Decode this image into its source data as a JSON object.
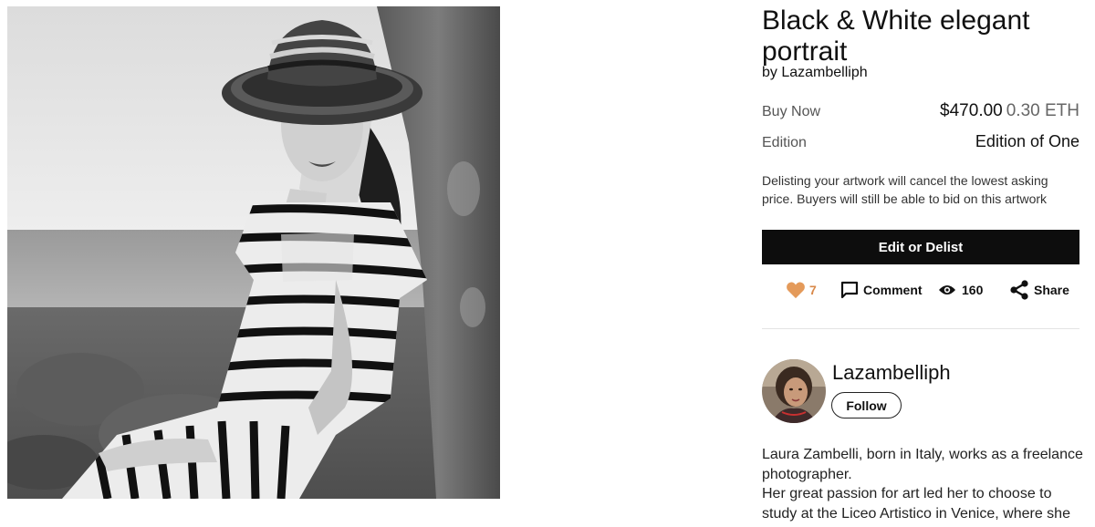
{
  "artwork": {
    "title": "Black & White elegant portrait",
    "artist_prefix": "by",
    "artist": "Lazambelliph"
  },
  "sale": {
    "buy_label": "Buy Now",
    "price_usd": "$470.00",
    "price_eth": "0.30 ETH",
    "edition_label": "Edition",
    "edition_value": "Edition of One"
  },
  "notice": "Delisting your artwork will cancel the lowest asking price. Buyers will still be able to bid on this artwork",
  "edit_button_label": "Edit or Delist",
  "actions": {
    "like_count": "7",
    "comment_label": "Comment",
    "view_count": "160",
    "share_label": "Share"
  },
  "profile": {
    "name": "Lazambelliph",
    "follow_label": "Follow",
    "bio_line_1": "Laura Zambelli, born in Italy, works as a freelance photographer.",
    "bio_line_2": "Her great passion for art led her to choose to study at the Liceo Artistico in Venice, where she"
  },
  "colors": {
    "button_bg": "#0d0d0d",
    "heart": "#e49a5a",
    "like_count": "#d9894a"
  },
  "icons": [
    "heart-icon",
    "comment-icon",
    "eye-icon",
    "share-icon"
  ]
}
